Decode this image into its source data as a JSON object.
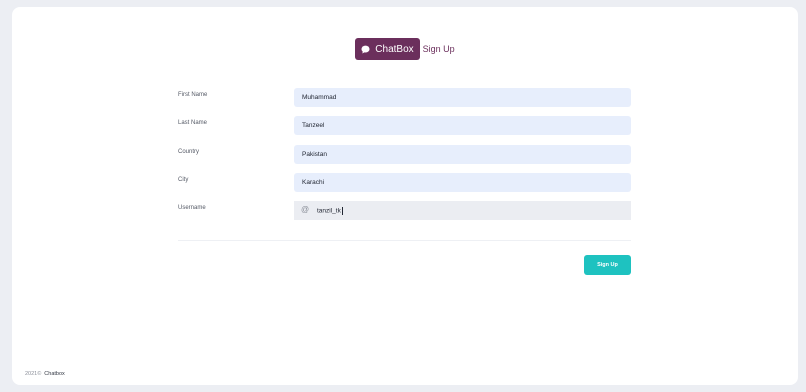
{
  "header": {
    "brand_name": "ChatBox",
    "title": "Sign Up",
    "brand_color": "#6b2f5c",
    "brand_icon": "chat-bubble-icon"
  },
  "form": {
    "first_name": {
      "label": "First Name",
      "value": "Muhammad"
    },
    "last_name": {
      "label": "Last Name",
      "value": "Tanzeel"
    },
    "country": {
      "label": "Country",
      "value": "Pakistan"
    },
    "city": {
      "label": "City",
      "value": "Karachi"
    },
    "username": {
      "label": "Username",
      "prefix": "@",
      "value": "tanzil_tk"
    }
  },
  "actions": {
    "signup_label": "Sign Up",
    "signup_color": "#1ec2c0"
  },
  "footer": {
    "year": "2021©",
    "brand": "Chatbox"
  }
}
